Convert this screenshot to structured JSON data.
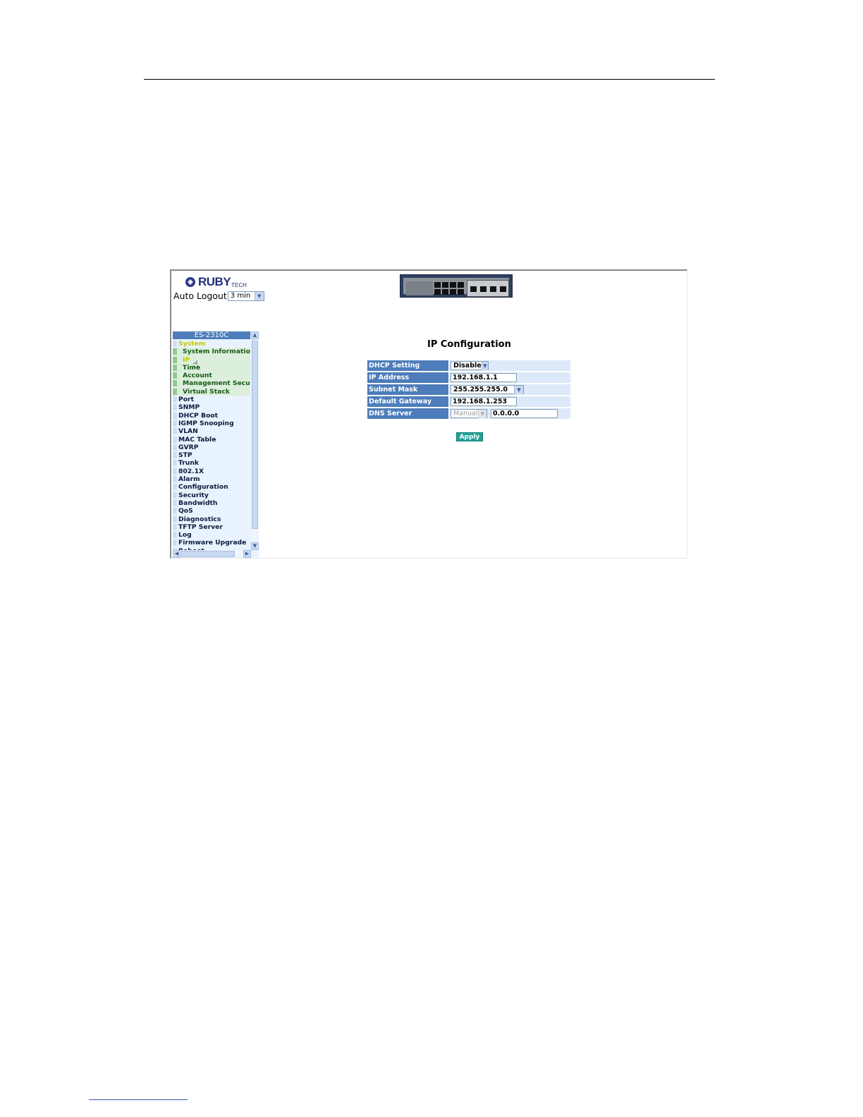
{
  "logo": {
    "text": "RUBY",
    "sub": "TECH"
  },
  "auto_logout": {
    "label": "Auto Logout",
    "value": "3 min"
  },
  "nav": {
    "title": "ES-2310C",
    "items": [
      {
        "label": "System",
        "level": "top",
        "state": "section-open"
      },
      {
        "label": "System Information",
        "level": "sub"
      },
      {
        "label": "IP",
        "level": "sub",
        "state": "active"
      },
      {
        "label": "Time",
        "level": "sub"
      },
      {
        "label": "Account",
        "level": "sub"
      },
      {
        "label": "Management Security",
        "level": "sub"
      },
      {
        "label": "Virtual Stack",
        "level": "sub"
      },
      {
        "label": "Port",
        "level": "top"
      },
      {
        "label": "SNMP",
        "level": "top"
      },
      {
        "label": "DHCP Boot",
        "level": "top"
      },
      {
        "label": "IGMP Snooping",
        "level": "top"
      },
      {
        "label": "VLAN",
        "level": "top"
      },
      {
        "label": "MAC Table",
        "level": "top"
      },
      {
        "label": "GVRP",
        "level": "top"
      },
      {
        "label": "STP",
        "level": "top"
      },
      {
        "label": "Trunk",
        "level": "top"
      },
      {
        "label": "802.1X",
        "level": "top"
      },
      {
        "label": "Alarm",
        "level": "top"
      },
      {
        "label": "Configuration",
        "level": "top"
      },
      {
        "label": "Security",
        "level": "top"
      },
      {
        "label": "Bandwidth",
        "level": "top"
      },
      {
        "label": "QoS",
        "level": "top"
      },
      {
        "label": "Diagnostics",
        "level": "top"
      },
      {
        "label": "TFTP Server",
        "level": "top"
      },
      {
        "label": "Log",
        "level": "top"
      },
      {
        "label": "Firmware Upgrade",
        "level": "top"
      },
      {
        "label": "Reboot",
        "level": "top"
      }
    ]
  },
  "main": {
    "title": "IP Configuration",
    "fields": {
      "dhcp_setting": {
        "label": "DHCP Setting",
        "value": "Disable"
      },
      "ip_address": {
        "label": "IP Address",
        "value": "192.168.1.1"
      },
      "subnet_mask": {
        "label": "Subnet Mask",
        "value": "255.255.255.0"
      },
      "default_gateway": {
        "label": "Default Gateway",
        "value": "192.168.1.253"
      },
      "dns_server": {
        "label": "DNS Server",
        "mode": "Manual",
        "value": "0.0.0.0"
      }
    },
    "apply_label": "Apply"
  },
  "icons": {
    "logo": "rubytech-logo-icon",
    "cursor": "hand-pointer-icon",
    "dropdown": "chevron-down-icon"
  },
  "colors": {
    "header_blue": "#4d7dba",
    "value_bg": "#dce9f8",
    "apply_teal": "#1fa39a",
    "nav_bg": "#e9f3ff",
    "sub_bg": "#dcefdc"
  }
}
